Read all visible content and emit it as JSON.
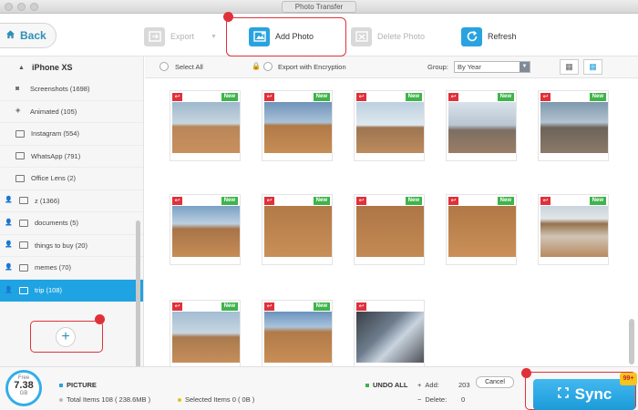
{
  "window": {
    "title": "Photo Transfer"
  },
  "toolbar": {
    "back": "Back",
    "export": "Export",
    "add_photo": "Add Photo",
    "delete_photo": "Delete Photo",
    "refresh": "Refresh"
  },
  "sidebar": {
    "device": "iPhone XS",
    "items": [
      {
        "label": "Screenshots (1698)"
      },
      {
        "label": "Animated (105)"
      },
      {
        "label": "Instagram (554)"
      },
      {
        "label": "WhatsApp (791)"
      },
      {
        "label": "Office Lens (2)"
      },
      {
        "label": "z (1366)"
      },
      {
        "label": "documents (5)"
      },
      {
        "label": "things to buy (20)"
      },
      {
        "label": "memes (70)"
      },
      {
        "label": "trip (108)"
      }
    ],
    "add_label": "+"
  },
  "filter": {
    "select_all": "Select All",
    "export_encryption": "Export with Encryption",
    "group_label": "Group:",
    "group_value": "By Year"
  },
  "photos": {
    "new_label": "New"
  },
  "bottom": {
    "free_label": "Free",
    "free_value": "7.38",
    "free_unit": "GB",
    "category": "PICTURE",
    "total": "Total Items 108 ( 238.6MB )",
    "selected": "Selected Items 0 ( 0B )",
    "undo_all": "UNDO ALL",
    "add_label": "Add:",
    "add_value": "203",
    "delete_label": "Delete:",
    "delete_value": "0",
    "cancel": "Cancel",
    "sync": "Sync",
    "badge": "99+"
  }
}
